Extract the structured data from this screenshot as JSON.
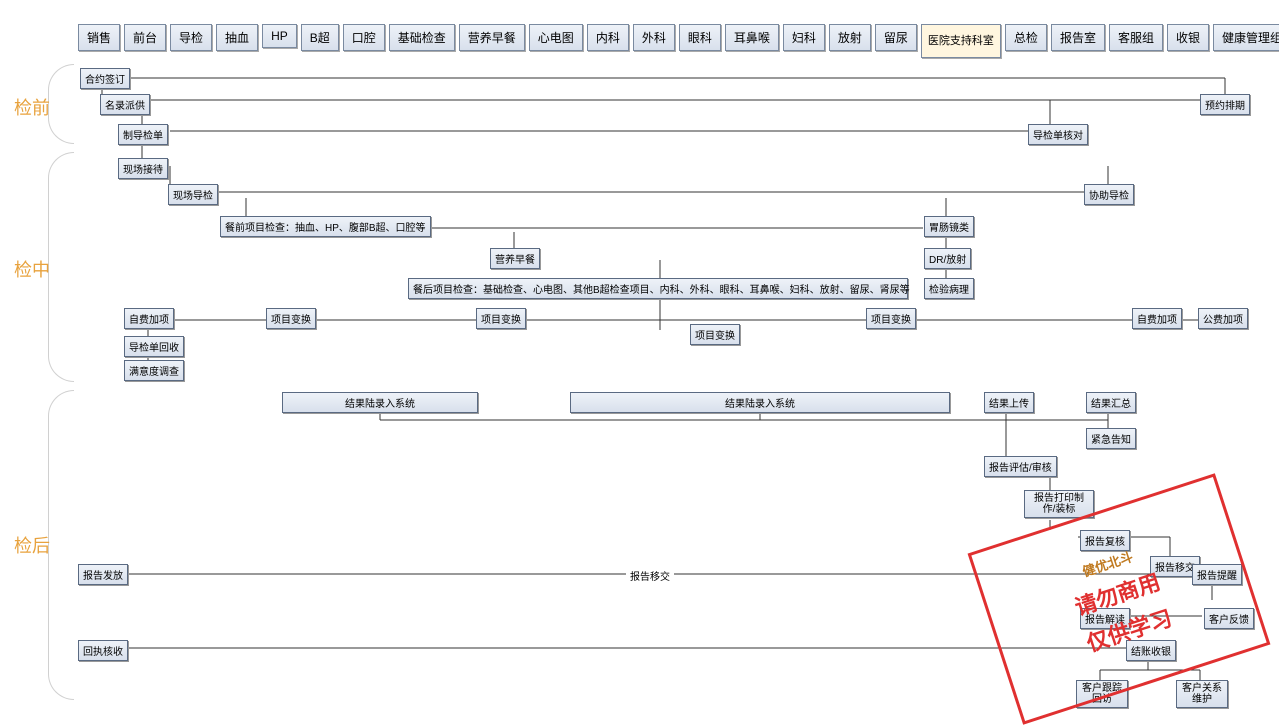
{
  "header": {
    "buttons": [
      "销售",
      "前台",
      "导检",
      "抽血",
      "HP",
      "B超",
      "口腔",
      "基础检查",
      "营养早餐",
      "心电图",
      "内科",
      "外科",
      "眼科",
      "耳鼻喉",
      "妇科",
      "放射",
      "留尿",
      "医院支持科室",
      "总检",
      "报告室",
      "客服组",
      "收银",
      "健康管理组"
    ],
    "highlighted_index": 17
  },
  "phases": {
    "pre": "检前",
    "mid": "检中",
    "post": "检后"
  },
  "nodes": {
    "n1": "合约签订",
    "n2": "名录派供",
    "n3": "预约排期",
    "n4": "制导检单",
    "n5": "导检单核对",
    "n6": "现场接待",
    "n7": "现场导检",
    "n8": "协助导检",
    "n9": "餐前项目检查：抽血、HP、腹部B超、口腔等",
    "n10": "胃肠镜类",
    "n11": "营养早餐",
    "n12": "DR/放射",
    "n13": "餐后项目检查：基础检查、心电图、其他B超检查项目、内科、外科、眼科、耳鼻喉、妇科、放射、留尿、肾尿等",
    "n14": "检验病理",
    "n15": "自费加项",
    "n16": "项目变换",
    "n17": "项目变换",
    "n18": "项目变换",
    "n19": "项目变换",
    "n20": "自费加项",
    "n21": "公费加项",
    "n22": "导检单回收",
    "n23": "满意度调查",
    "n24": "结果陆录入系统",
    "n25": "结果陆录入系统",
    "n26": "结果上传",
    "n27": "结果汇总",
    "n28": "紧急告知",
    "n29": "报告评估/审核",
    "n30": "报告打印制作/装标",
    "n31": "报告复核",
    "n32": "报告移交",
    "n33": "报告发放",
    "n34": "报告移交",
    "n35": "报告提醒",
    "n36": "报告解读",
    "n37": "客户反馈",
    "n38": "回执核收",
    "n39": "结账收银",
    "n40": "客户跟踪回访",
    "n41": "客户关系维护"
  },
  "watermark": {
    "logo": "健优北斗",
    "line1": "仅供学习",
    "line2": "请勿商用"
  }
}
